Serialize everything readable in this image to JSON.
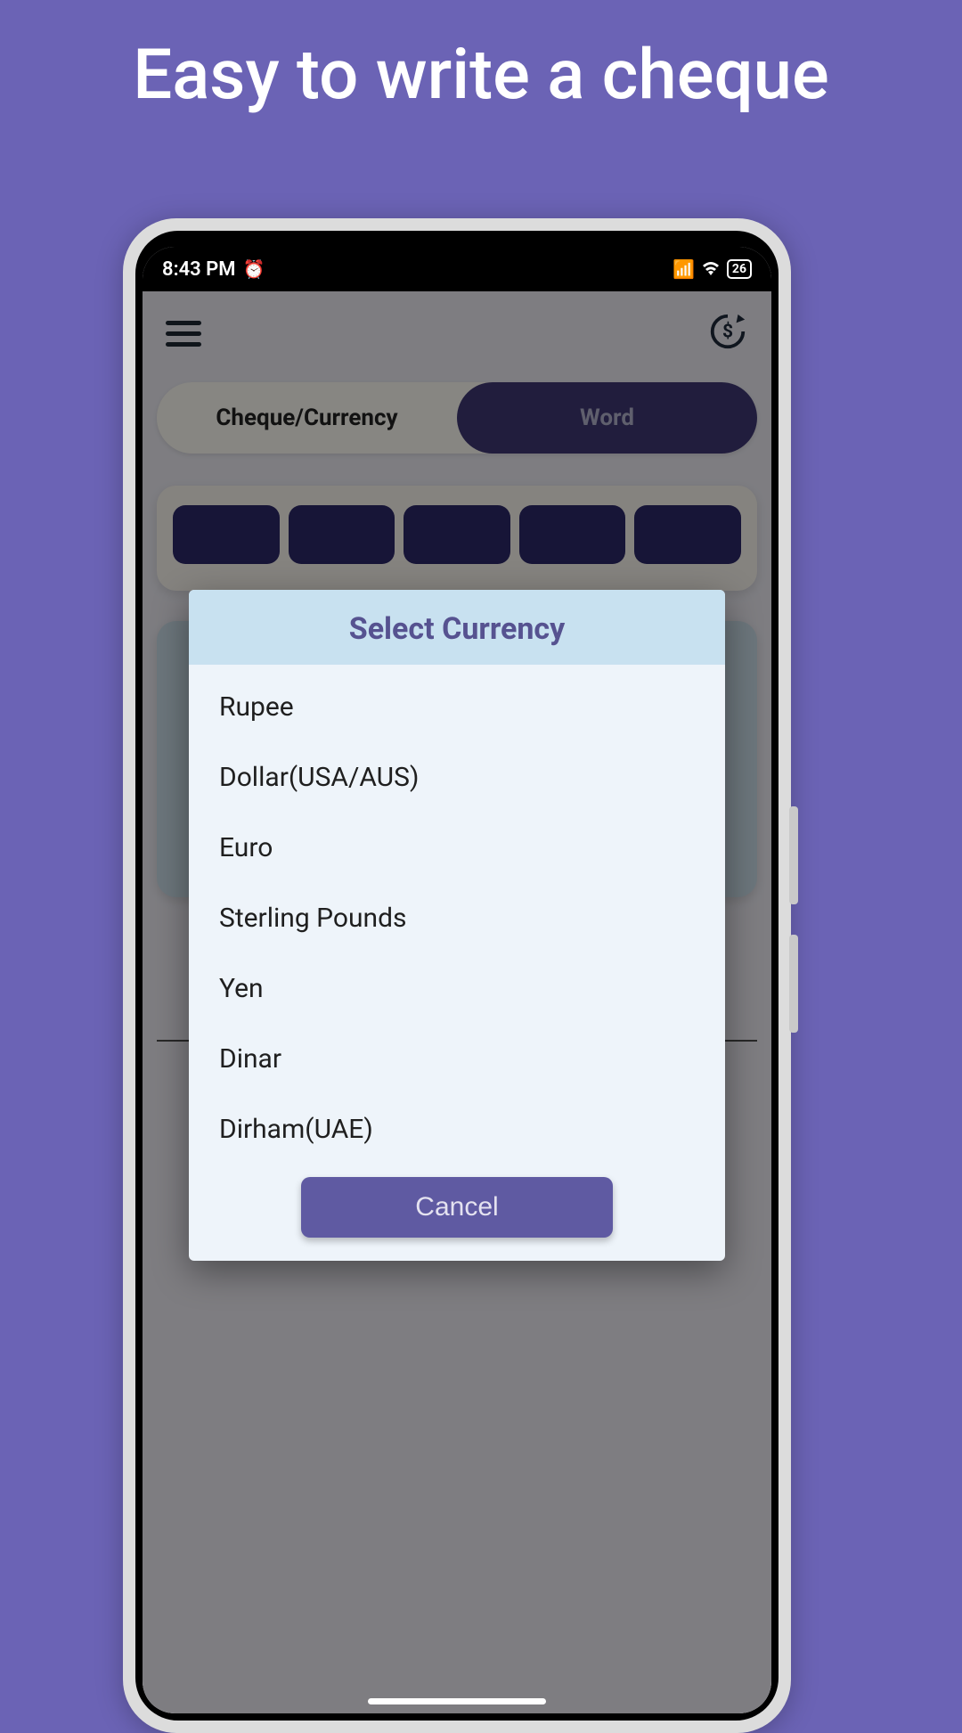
{
  "headline": "Easy to write a cheque",
  "status": {
    "time": "8:43 PM",
    "battery": "26"
  },
  "segmented": {
    "left": "Cheque/Currency",
    "right": "Word"
  },
  "dialog": {
    "title": "Select Currency",
    "items": [
      "Rupee",
      "Dollar(USA/AUS)",
      "Euro",
      "Sterling Pounds",
      "Yen",
      "Dinar",
      "Dirham(UAE)"
    ],
    "cancel": "Cancel"
  }
}
